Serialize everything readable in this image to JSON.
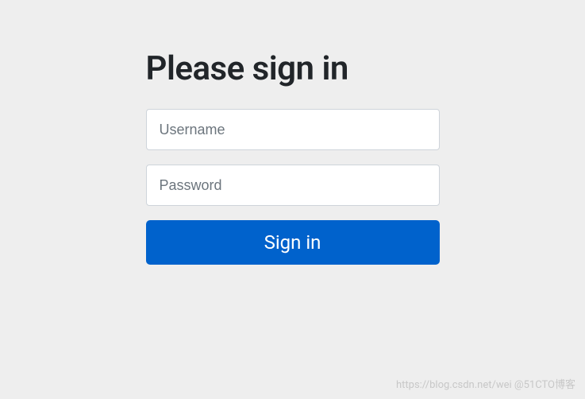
{
  "form": {
    "title": "Please sign in",
    "username": {
      "placeholder": "Username",
      "value": ""
    },
    "password": {
      "placeholder": "Password",
      "value": ""
    },
    "submit_label": "Sign in"
  },
  "watermark": "https://blog.csdn.net/wei @51CTO博客"
}
